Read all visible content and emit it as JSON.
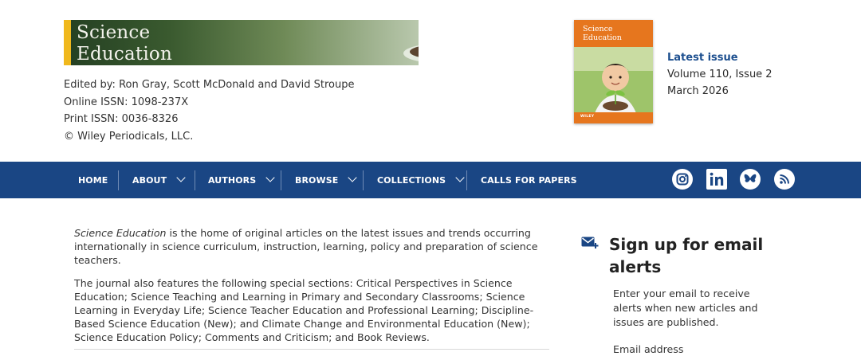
{
  "journal": {
    "title_line1": "Science",
    "title_line2": "Education",
    "editors": "Edited by: Ron Gray, Scott McDonald and David Stroupe",
    "online_issn": "Online ISSN: 1098-237X",
    "print_issn": "Print ISSN: 0036-8326",
    "copyright": "© Wiley Periodicals, LLC."
  },
  "cover": {
    "title_line1": "Science",
    "title_line2": "Education",
    "publisher": "WILEY",
    "color": "#e6761e"
  },
  "latest": {
    "link": "Latest issue",
    "volume": "Volume 110, Issue 2",
    "date": "March 2026"
  },
  "nav": {
    "items": [
      {
        "label": "HOME",
        "dropdown": false
      },
      {
        "label": "ABOUT",
        "dropdown": true
      },
      {
        "label": "AUTHORS",
        "dropdown": true
      },
      {
        "label": "BROWSE",
        "dropdown": true
      },
      {
        "label": "COLLECTIONS",
        "dropdown": true
      },
      {
        "label": "CALLS FOR PAPERS",
        "dropdown": false
      }
    ],
    "social": [
      "instagram-icon",
      "linkedin-icon",
      "bluesky-icon",
      "rss-icon"
    ],
    "bg": "#1a4684"
  },
  "main": {
    "intro_italic": "Science Education",
    "intro_rest": " is the home of original articles on the latest issues and trends occurring internationally in science curriculum, instruction, learning, policy and preparation of science teachers.",
    "sections": "The journal also features the following special sections: Critical Perspectives in Science Education; Science Teaching and Learning in Primary and Secondary Classrooms; Science Learning in Everyday Life; Science Teacher Education and Professional Learning; Discipline-Based Science Education (New); and Climate Change and Environmental Education (New); Science Education Policy; Comments and Criticism; and Book Reviews."
  },
  "alerts": {
    "title": "Sign up for email alerts",
    "text": "Enter your email to receive alerts when new articles and issues are published.",
    "email_label": "Email address",
    "icon": "mail-plus-icon"
  }
}
